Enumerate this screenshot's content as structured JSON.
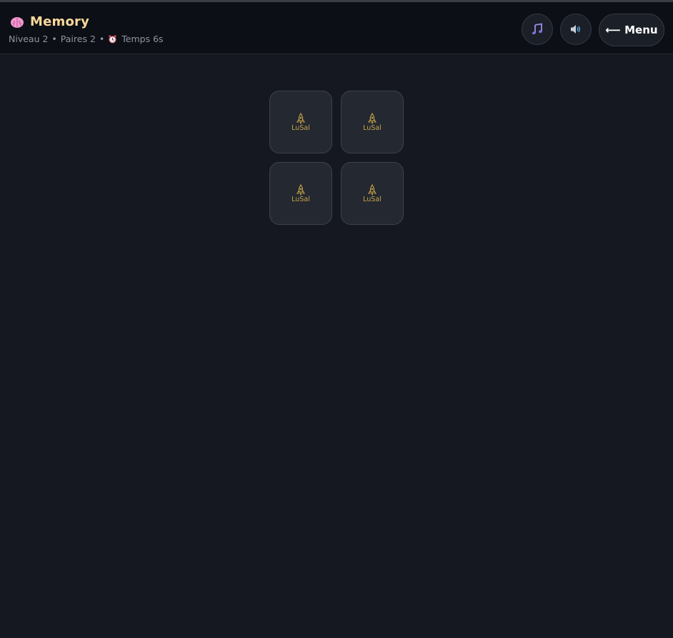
{
  "header": {
    "title": "Memory",
    "title_icon": "brain-icon",
    "stats": {
      "level": "Niveau 2",
      "pairs": "Paires 2",
      "separator": "•",
      "timer_icon": "alarm-clock-icon",
      "time": "Temps 6s"
    },
    "buttons": {
      "music_icon": "music-note-icon",
      "sound_icon": "speaker-icon",
      "menu_label": "⟵ Menu"
    }
  },
  "board": {
    "cards": [
      {
        "state": "face-down",
        "logo_text": "LuSal"
      },
      {
        "state": "face-down",
        "logo_text": "LuSal"
      },
      {
        "state": "face-down",
        "logo_text": "LuSal"
      },
      {
        "state": "face-down",
        "logo_text": "LuSal"
      }
    ]
  },
  "colors": {
    "background": "#151820",
    "header_bg": "#0c0f15",
    "title": "#fcd89a",
    "card_bg": "#242831",
    "logo_gold": "#c9a548"
  }
}
